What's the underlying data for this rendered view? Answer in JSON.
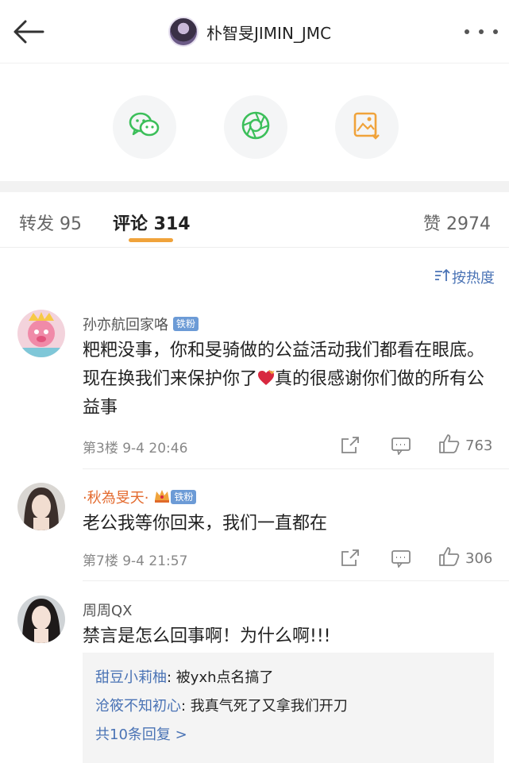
{
  "header": {
    "title": "朴智旻JIMIN_JMC",
    "icons": {
      "back": "back-arrow-icon",
      "more": "more-dots-icon"
    }
  },
  "share": {
    "icons": [
      "wechat-icon",
      "moments-icon",
      "save-image-icon"
    ],
    "colors": {
      "wechat": "#3cbf5a",
      "moments": "#3cbf5a",
      "save": "#f0a33b"
    }
  },
  "tabs": {
    "repost": "转发 95",
    "comments": "评论 314",
    "likes": "赞 2974"
  },
  "sort_label": "按热度",
  "comments": [
    {
      "user": "孙亦航回家咯",
      "badge": "铁粉",
      "text_a": "粑粑没事，你和旻骑做的公益活动我们都看在眼底。现在换我们来保护你了",
      "emoji": "heart-icon",
      "text_b": "真的很感谢你们做的所有公益事",
      "floor_time": "第3楼 9-4 20:46",
      "likes": "763"
    },
    {
      "user": "·秋為旻天·",
      "badge": "铁粉",
      "text": "老公我等你回来，我们一直都在",
      "floor_time": "第7楼 9-4 21:57",
      "likes": "306"
    },
    {
      "user": "周周QX",
      "text": "禁言是怎么回事啊！为什么啊!!!",
      "replies": [
        {
          "name": "甜豆小莉柚",
          "text": ": 被yxh点名搞了"
        },
        {
          "name": "沧筱不知初心",
          "text": ": 我真气死了又拿我们开刀"
        }
      ],
      "more_replies": "共10条回复 >"
    }
  ],
  "accent": "#f0a33b",
  "link_color": "#4a73b5"
}
